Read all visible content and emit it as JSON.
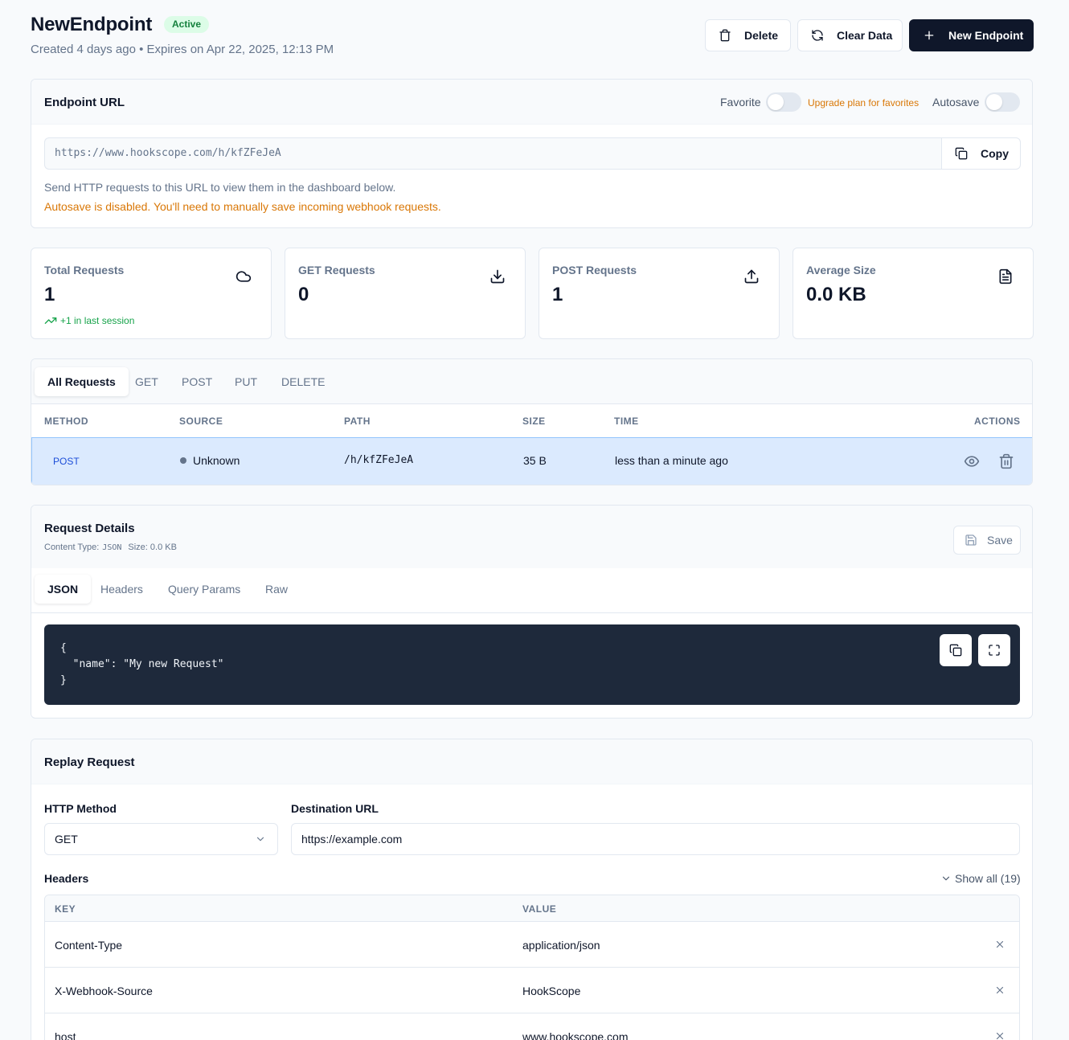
{
  "header": {
    "title": "NewEndpoint",
    "status_badge": "Active",
    "subtitle": "Created 4 days ago • Expires on Apr 22, 2025, 12:13 PM",
    "buttons": {
      "delete": "Delete",
      "clear": "Clear Data",
      "new": "New Endpoint"
    }
  },
  "endpoint": {
    "title": "Endpoint URL",
    "favorite_label": "Favorite",
    "upgrade_text": "Upgrade plan for favorites",
    "autosave_label": "Autosave",
    "url": "https://www.hookscope.com/h/kfZFeJeA",
    "copy_label": "Copy",
    "help_text": "Send HTTP requests to this URL to view them in the dashboard below.",
    "autosave_warning": "Autosave is disabled. You'll need to manually save incoming webhook requests."
  },
  "stats": [
    {
      "label": "Total Requests",
      "value": "1",
      "icon": "cloud-icon",
      "trend": "+1 in last session"
    },
    {
      "label": "GET Requests",
      "value": "0",
      "icon": "download-icon"
    },
    {
      "label": "POST Requests",
      "value": "1",
      "icon": "upload-icon"
    },
    {
      "label": "Average Size",
      "value": "0.0 KB",
      "icon": "file-icon"
    }
  ],
  "requests": {
    "tabs": [
      "All Requests",
      "GET",
      "POST",
      "PUT",
      "DELETE"
    ],
    "columns": [
      "METHOD",
      "SOURCE",
      "PATH",
      "SIZE",
      "TIME",
      "ACTIONS"
    ],
    "rows": [
      {
        "method": "POST",
        "source": "Unknown",
        "path": "/h/kfZFeJeA",
        "size": "35 B",
        "time": "less than a minute ago"
      }
    ]
  },
  "details": {
    "title": "Request Details",
    "content_type_label": "Content Type:",
    "content_type": "JSON",
    "size_text": "Size: 0.0 KB",
    "save_label": "Save",
    "tabs": [
      "JSON",
      "Headers",
      "Query Params",
      "Raw"
    ],
    "code_lines": [
      "{",
      "  \"name\": \"My new Request\"",
      "}"
    ]
  },
  "replay": {
    "title": "Replay Request",
    "method_label": "HTTP Method",
    "method_value": "GET",
    "url_label": "Destination URL",
    "url_value": "https://example.com",
    "headers_label": "Headers",
    "show_all": "Show all (19)",
    "columns": [
      "KEY",
      "VALUE"
    ],
    "headers": [
      {
        "key": "Content-Type",
        "value": "application/json"
      },
      {
        "key": "X-Webhook-Source",
        "value": "HookScope"
      },
      {
        "key": "host",
        "value": "www.hookscope.com"
      }
    ]
  },
  "colors": {
    "accent": "#0f172a",
    "success": "#16a34a",
    "warning": "#d97706",
    "selected_row": "#dbeafe",
    "post_method": "#1d4ed8"
  }
}
